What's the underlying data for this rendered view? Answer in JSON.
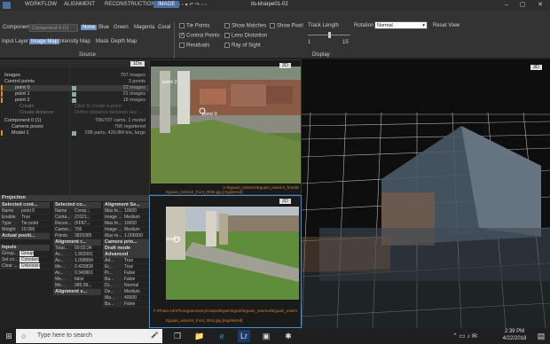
{
  "titlebar": {
    "tabs": [
      "WORKFLOW",
      "ALIGNMENT",
      "RECONSTRUCTION",
      "IMAGE"
    ],
    "app_title": "its-kharpe01-02",
    "help": "RC",
    "colors": {
      "active_tab": "#4a6fa5"
    }
  },
  "ribbon": {
    "component_label": "Component",
    "component_value": "Component 0 (1)",
    "channels": [
      "None",
      "Blue",
      "Green",
      "Magenta",
      "Coral"
    ],
    "left_buttons": [
      "Input Layer",
      "Image Map",
      "Intensity Map",
      "Mask",
      "Depth Map"
    ],
    "checkboxes_col1": [
      "Tie Points",
      "Control Points",
      "Residuals"
    ],
    "checkboxes_col2": [
      "Show Matches",
      "Lens Distortion",
      "Ray of Sight"
    ],
    "show_pixel": "Show Pixel",
    "track_length_label": "Track Length",
    "track_min": "1",
    "track_max": "15",
    "rotation_label": "Rotation",
    "rotation_value": "Normal",
    "reset_view": "Reset View",
    "source_label": "Source",
    "display_label": "Display"
  },
  "tree": {
    "tag": "1Ds",
    "rows": [
      {
        "label": "Images",
        "val": "707 images"
      },
      {
        "label": "Control points",
        "val": "3 points"
      },
      {
        "label": "point 0",
        "val": "22 images"
      },
      {
        "label": "point 1",
        "val": "21 images"
      },
      {
        "label": "point 2",
        "val": "18 images"
      },
      {
        "label": "Create",
        "val": "Click to create a point"
      },
      {
        "label": "Create distance",
        "val": "Define distance between two ..."
      },
      {
        "label": "Component 0 (1)",
        "val": "706/707 cams, 1 model"
      },
      {
        "label": "Camera poses",
        "val": "706 registered"
      },
      {
        "label": "Model 1",
        "val": "298 parts, 420.8M tris, large"
      }
    ]
  },
  "view_top": {
    "tag": "2D",
    "point_label_a": "point 2",
    "point_label_b": "point 0",
    "path": "H:\\Eguain_exterior\\Eguain_exterior_front\\E",
    "filename": "Eguain_exterior_front_0006.jpg [registered]"
  },
  "view_bottom": {
    "tag": "2D",
    "point_label": "point 0",
    "path": "F:\\Photo-AE\\Photogrammetry\\Output\\Egain\\Egain\\Eguain_exterior\\Eguain_exterior_front\\E",
    "filename": "Eguain_exterior_front_0011.jpg [registered]"
  },
  "view3d": {
    "tag": "3D"
  },
  "props": {
    "projection": "Projection",
    "selected_cp": "Selected cont...",
    "selected_comp": "Selected co...",
    "alignment_settings": "Alignment Se...",
    "cp_rows": [
      {
        "k": "Name",
        "v": "point 0"
      },
      {
        "k": "Enable",
        "v": "True"
      },
      {
        "k": "Type",
        "v": "Tie point"
      },
      {
        "k": "Weight",
        "v": "10.000"
      }
    ],
    "actual_position": "Actual positi...",
    "inputs": "Inputs",
    "input_rows": [
      {
        "k": "Group...",
        "v": "Group"
      },
      {
        "k": "Set co...",
        "v": "Constant"
      },
      {
        "k": "Clear ...",
        "v": "Unknown"
      }
    ],
    "comp_rows": [
      {
        "k": "Name",
        "v": "Comp..."
      },
      {
        "k": "Conta...",
        "v": "(C621..."
      },
      {
        "k": "Recon...",
        "v": "(FF67..."
      },
      {
        "k": "Camer...",
        "v": "706"
      },
      {
        "k": "Points",
        "v": "3829385"
      }
    ],
    "alignment_report": "Alignment r...",
    "report_rows": [
      {
        "k": "Total...",
        "v": "00:02:34"
      },
      {
        "k": "Av...",
        "v": "1.862001"
      },
      {
        "k": "Av...",
        "v": "1.098994"
      },
      {
        "k": "Me...",
        "v": "0.420838"
      },
      {
        "k": "Av...",
        "v": "0.340861"
      },
      {
        "k": "Me...",
        "v": "false"
      },
      {
        "k": "Me...",
        "v": "085.09..."
      }
    ],
    "alignment_s": "Alignment s...",
    "align_rows": [
      {
        "k": "Max fe...",
        "v": "10000"
      },
      {
        "k": "Image ...",
        "v": "Medium"
      },
      {
        "k": "Max fe...",
        "v": "10000"
      },
      {
        "k": "Image ...",
        "v": "Medium"
      },
      {
        "k": "Max re...",
        "v": "1.000000"
      }
    ],
    "camera_prior": "Camera prio...",
    "draft_mode": "Draft mode",
    "advanced": "Advanced",
    "adv_rows": [
      {
        "k": "Ad...",
        "v": "True"
      },
      {
        "k": "Er...",
        "v": "True"
      },
      {
        "k": "Pr...",
        "v": "False"
      },
      {
        "k": "Ba...",
        "v": "False"
      },
      {
        "k": "Di...",
        "v": "Normal"
      },
      {
        "k": "De...",
        "v": "Medium"
      },
      {
        "k": "Ma...",
        "v": "40000"
      },
      {
        "k": "Ba...",
        "v": "False"
      }
    ]
  },
  "taskbar": {
    "search_placeholder": "Type here to search",
    "time": "2:39 PM",
    "date": "4/22/2018"
  }
}
